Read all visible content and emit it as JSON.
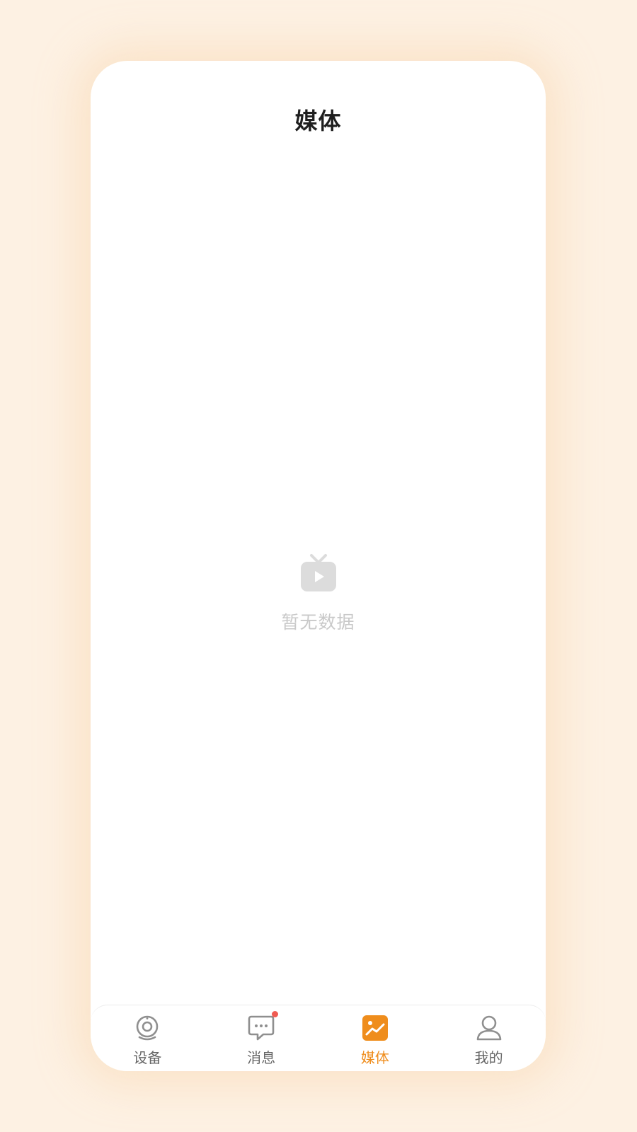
{
  "header": {
    "title": "媒体"
  },
  "empty_state": {
    "icon": "tv-play-icon",
    "text": "暂无数据"
  },
  "tabbar": {
    "items": [
      {
        "label": "设备",
        "icon": "camera-icon",
        "active": false
      },
      {
        "label": "消息",
        "icon": "chat-bubble-icon",
        "active": false,
        "badge": true
      },
      {
        "label": "媒体",
        "icon": "gallery-icon",
        "active": true
      },
      {
        "label": "我的",
        "icon": "user-icon",
        "active": false
      }
    ]
  },
  "colors": {
    "background": "#fdf1e3",
    "accent": "#ef8d1c",
    "badge": "#ef5b52",
    "inactive_icon": "#8f8f8f",
    "empty_text": "#c9c9c9"
  }
}
